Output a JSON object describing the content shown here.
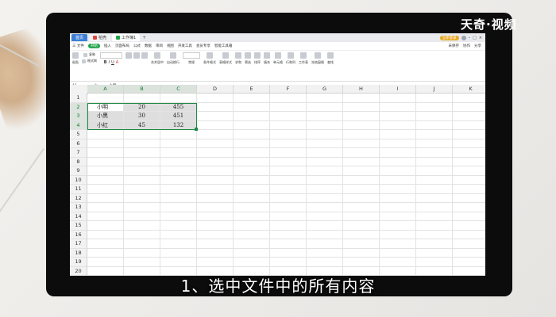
{
  "watermark": "天奇·视频",
  "caption": "1、选中文件中的所有内容",
  "titlebar": {
    "tabs": [
      {
        "label": "首页"
      },
      {
        "label": "稻壳"
      },
      {
        "label": "工作簿1"
      }
    ],
    "new_tab": "+",
    "vip_label": "立即登录"
  },
  "menu": {
    "items": [
      "三 文件",
      "开始",
      "插入",
      "页面布局",
      "公式",
      "数据",
      "审阅",
      "视图",
      "开发工具",
      "会员专享",
      "智能工具箱"
    ],
    "active_index": 1,
    "right": [
      "未保存",
      "协作",
      "分享"
    ]
  },
  "ribbon": {
    "groups": [
      "粘贴",
      "复制",
      "格式刷",
      "宋体",
      "B",
      "合并居中",
      "自动换行",
      "常规",
      "条件格式",
      "表格样式",
      "求和",
      "筛选",
      "排序",
      "填充",
      "单元格",
      "行和列",
      "工作表",
      "冻结窗格",
      "查找"
    ]
  },
  "formula_bar": {
    "name_box": "A1",
    "fx": "fx",
    "value": "小明"
  },
  "sheet": {
    "columns": [
      "A",
      "B",
      "C",
      "D",
      "E",
      "F",
      "G",
      "H",
      "I",
      "J",
      "K"
    ],
    "rows": [
      "1",
      "2",
      "3",
      "4",
      "5",
      "6",
      "7",
      "8",
      "9",
      "10",
      "11",
      "12",
      "13",
      "14",
      "15",
      "16",
      "17",
      "18",
      "19",
      "20"
    ],
    "data": [
      [
        "小明",
        "20",
        "455"
      ],
      [
        "小黑",
        "30",
        "451"
      ],
      [
        "小红",
        "45",
        "132"
      ]
    ]
  }
}
